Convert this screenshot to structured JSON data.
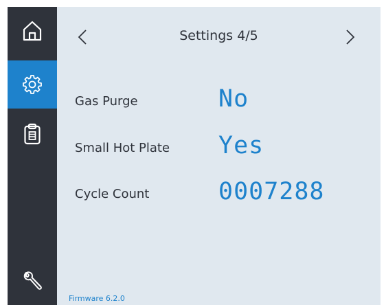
{
  "sidebar": {
    "items": [
      {
        "icon": "home-icon",
        "active": false
      },
      {
        "icon": "gear-icon",
        "active": true
      },
      {
        "icon": "clipboard-icon",
        "active": false
      },
      {
        "icon": "wrench-icon",
        "active": false
      }
    ]
  },
  "header": {
    "title": "Settings 4/5",
    "prev_icon": "chevron-left-icon",
    "next_icon": "chevron-right-icon"
  },
  "settings": [
    {
      "label": "Gas Purge",
      "value": "No"
    },
    {
      "label": "Small Hot Plate",
      "value": "Yes"
    },
    {
      "label": "Cycle Count",
      "value": "0007288"
    }
  ],
  "footer": {
    "firmware": "Firmware 6.2.0"
  },
  "colors": {
    "sidebar_bg": "#2f333b",
    "accent": "#1e82cc",
    "content_bg": "#e0e8ef",
    "text": "#2f333b"
  }
}
